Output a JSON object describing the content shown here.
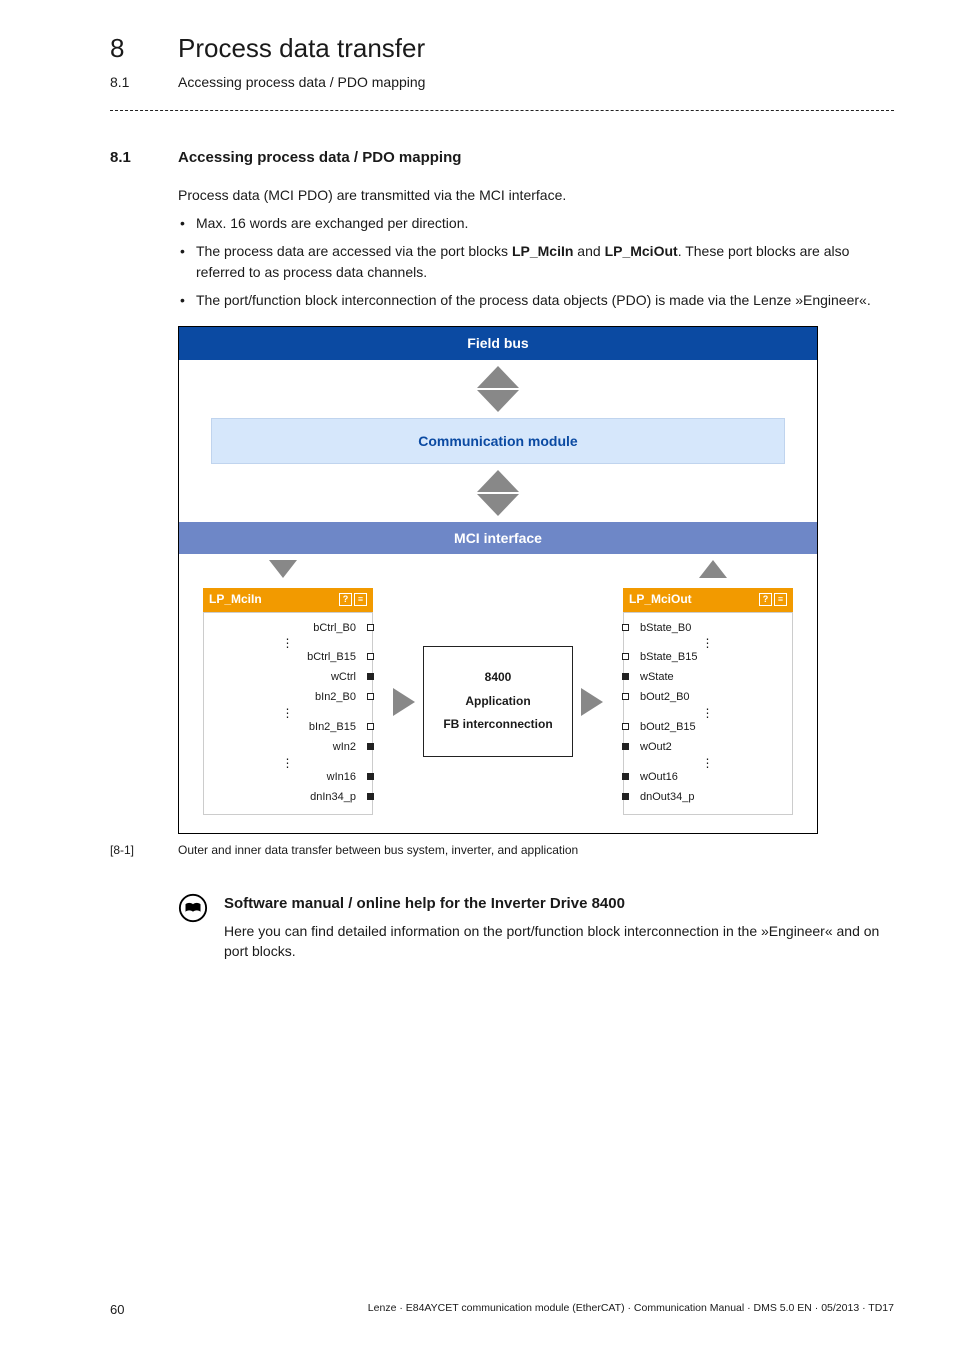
{
  "chapter": {
    "num": "8",
    "title": "Process data transfer"
  },
  "subhead": {
    "num": "8.1",
    "title": "Accessing process data / PDO mapping"
  },
  "section": {
    "num": "8.1",
    "title": "Accessing process data / PDO mapping"
  },
  "intro": "Process data (MCI PDO) are transmitted via the MCI interface.",
  "bullets": {
    "b1": "Max. 16 words are exchanged per direction.",
    "b2_a": "The process data are accessed via the port blocks ",
    "b2_bold1": "LP_MciIn",
    "b2_mid": " and ",
    "b2_bold2": "LP_MciOut",
    "b2_b": ". These port blocks are also referred to as process data channels.",
    "b3": "The port/function block interconnection of the process data objects (PDO) is made via the Lenze »Engineer«."
  },
  "diagram": {
    "fieldbus": "Field bus",
    "comm": "Communication module",
    "mci": "MCI interface",
    "left_hdr": "LP_MciIn",
    "right_hdr": "LP_MciOut",
    "left_rows": {
      "r0": "bCtrl_B0",
      "r1": "bCtrl_B15",
      "r2": "wCtrl",
      "r3": "bIn2_B0",
      "r4": "bIn2_B15",
      "r5": "wIn2",
      "r6": "wIn16",
      "r7": "dnIn34_p"
    },
    "right_rows": {
      "r0": "bState_B0",
      "r1": "bState_B15",
      "r2": "wState",
      "r3": "bOut2_B0",
      "r4": "bOut2_B15",
      "r5": "wOut2",
      "r6": "wOut16",
      "r7": "dnOut34_p"
    },
    "app": {
      "l1": "8400",
      "l2": "Application",
      "l3": "FB interconnection"
    }
  },
  "caption": {
    "num": "[8-1]",
    "text": "Outer and inner data transfer between bus system, inverter, and application"
  },
  "note": {
    "title": "Software manual / online help for the Inverter Drive 8400",
    "body": "Here you can find detailed information on the port/function block interconnection in the »Engineer« and on port blocks."
  },
  "footer": {
    "page": "60",
    "line": "Lenze · E84AYCET communication module (EtherCAT) · Communication Manual · DMS 5.0 EN · 05/2013 · TD17"
  }
}
